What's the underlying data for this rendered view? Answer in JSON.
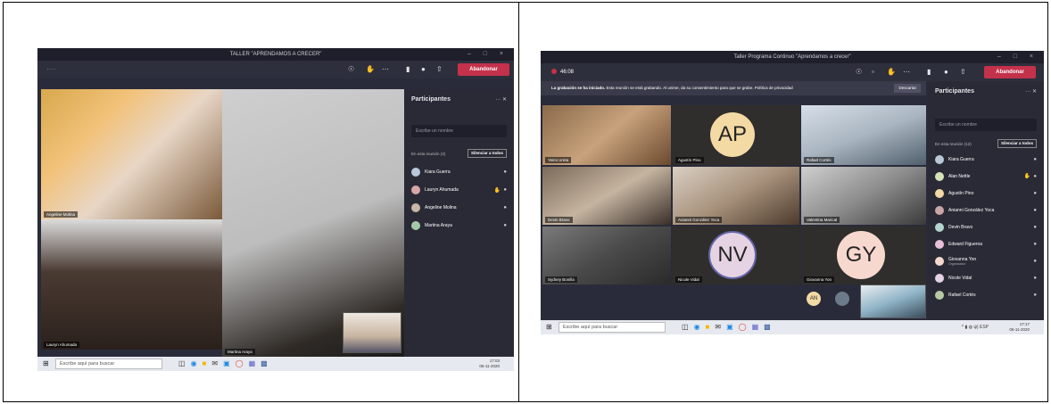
{
  "left": {
    "window_title": "TALLER \"APRENDAMOS A CRECER\"",
    "window_controls": "–  □  ×",
    "toolbar": {
      "more": "····",
      "leave_label": "Abandonar"
    },
    "tiles": [
      {
        "name": "Angeline Molina"
      },
      {
        "name": "Lauryn Ahumada"
      },
      {
        "name": "Martina Araya"
      }
    ],
    "panel": {
      "title": "Participantes",
      "search_placeholder": "Escribe un nombre",
      "section": "En esta reunión (4)",
      "mute_all": "Silenciar a todos",
      "people": [
        {
          "name": "Kiara Guerra",
          "color": "#b9c8d6",
          "hand": false
        },
        {
          "name": "Lauryn Ahumada",
          "color": "#d9a6a6",
          "hand": true
        },
        {
          "name": "Angeline Molina",
          "color": "#c9b7a5",
          "hand": false
        },
        {
          "name": "Martina Araya",
          "color": "#a5c9a7",
          "hand": false
        }
      ]
    },
    "taskbar": {
      "search": "Escribe aquí para buscar",
      "time": "17:03",
      "date": "05-11-2020"
    }
  },
  "right": {
    "window_title": "Taller Programa Continuo \"Aprendamos a crecer\"",
    "window_controls": "–  □  ×",
    "toolbar": {
      "timer": "46:08",
      "leave_label": "Abandonar"
    },
    "banner": {
      "bold": "La grabación se ha iniciado.",
      "text": "Esta reunión se está grabando. Al unirse, da su consentimiento para que se grabe. Política de privacidad",
      "dismiss": "Descartar"
    },
    "tiles": [
      {
        "name": "Yeimi Ureta"
      },
      {
        "name": "Agustín Pino",
        "initials": "AP",
        "color": "#f3d9a4"
      },
      {
        "name": "Rafael Cortés"
      },
      {
        "name": "Devin Bravo"
      },
      {
        "name": "Anianni González Yoca"
      },
      {
        "name": "Valentina Marical"
      },
      {
        "name": "Sydney Bonilla"
      },
      {
        "name": "Nicole Vidal",
        "initials": "NV",
        "color": "#e5d3e3"
      },
      {
        "name": "Giovanna Yon",
        "initials": "GY",
        "color": "#f7d8cf"
      }
    ],
    "overflow": {
      "initials": "AN"
    },
    "panel": {
      "title": "Participantes",
      "search_placeholder": "Escribe un nombre",
      "section": "En esta reunión (12)",
      "mute_all": "Silenciar a todos",
      "people": [
        {
          "name": "Kiara Guerra",
          "color": "#b9c8d6",
          "hand": false,
          "role": ""
        },
        {
          "name": "Alan Nettle",
          "color": "#d6e3b9",
          "hand": true,
          "role": ""
        },
        {
          "name": "Agustín Pino",
          "color": "#f3d9a4",
          "hand": false,
          "role": ""
        },
        {
          "name": "Anianni González Yoca",
          "color": "#c9a5a5",
          "hand": false,
          "role": ""
        },
        {
          "name": "Devin Bravo",
          "color": "#b5d4cf",
          "hand": false,
          "role": ""
        },
        {
          "name": "Edward Figueroa",
          "color": "#e6c0d8",
          "hand": false,
          "role": ""
        },
        {
          "name": "Giovanna Yon",
          "color": "#f7d8cf",
          "hand": false,
          "role": "Organizador"
        },
        {
          "name": "Nicole Vidal",
          "color": "#e5d3e3",
          "hand": false,
          "role": ""
        },
        {
          "name": "Rafael Cortés",
          "color": "#b7c9a5",
          "hand": false,
          "role": ""
        }
      ]
    },
    "taskbar": {
      "search": "Escribe aquí para buscar",
      "tray": "^ ▮ ◍ ψ) ESP",
      "time": "17:17",
      "date": "05-11-2020"
    }
  }
}
